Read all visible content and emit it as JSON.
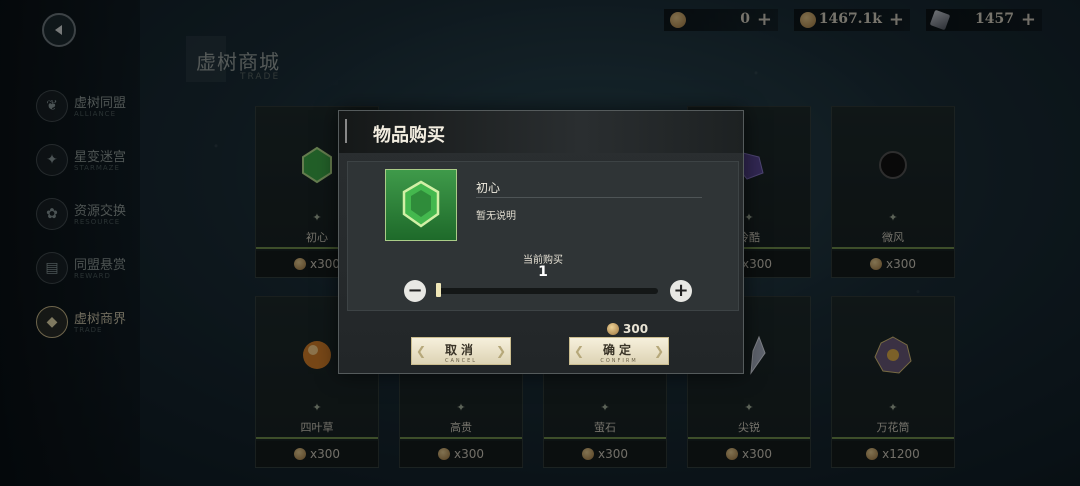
{
  "currencies": [
    {
      "icon": "coin-icon",
      "value": "0"
    },
    {
      "icon": "coin-icon",
      "value": "1467.1k"
    },
    {
      "icon": "crystal-icon",
      "value": "1457"
    }
  ],
  "shop": {
    "title": "虚树商城",
    "subtitle": "TRADE"
  },
  "sidebar": {
    "items": [
      {
        "label": "虚树同盟",
        "sub": "ALLIANCE",
        "icon": "tree-icon"
      },
      {
        "label": "星变迷宫",
        "sub": "STARMAZE",
        "icon": "star-icon"
      },
      {
        "label": "资源交换",
        "sub": "RESOURCE",
        "icon": "flower-icon"
      },
      {
        "label": "同盟悬赏",
        "sub": "REWARD",
        "icon": "scroll-icon"
      },
      {
        "label": "虚树商界",
        "sub": "TRADE",
        "icon": "shop-icon"
      }
    ]
  },
  "items": [
    {
      "name": "初心",
      "price": "x300"
    },
    {
      "name": "冷酷",
      "price": "x300"
    },
    {
      "name": "微风",
      "price": "x300"
    },
    {
      "name": "四叶草",
      "price": "x300"
    },
    {
      "name": "高贵",
      "price": "x300"
    },
    {
      "name": "萤石",
      "price": "x300"
    },
    {
      "name": "尖锐",
      "price": "x300"
    },
    {
      "name": "万花筒",
      "price": "x1200"
    }
  ],
  "modal": {
    "title": "物品购买",
    "item_name": "初心",
    "item_desc": "暂无说明",
    "qty_label": "当前购买",
    "qty_value": "1",
    "slider_fraction": 0.0,
    "cost": "300",
    "cancel_label": "取消",
    "cancel_sub": "CANCEL",
    "confirm_label": "确定",
    "confirm_sub": "CONFIRM"
  },
  "colors": {
    "accent": "#d8c990",
    "rarity_line": "#6f8f4e",
    "button_bg": "#f6f0dc"
  }
}
